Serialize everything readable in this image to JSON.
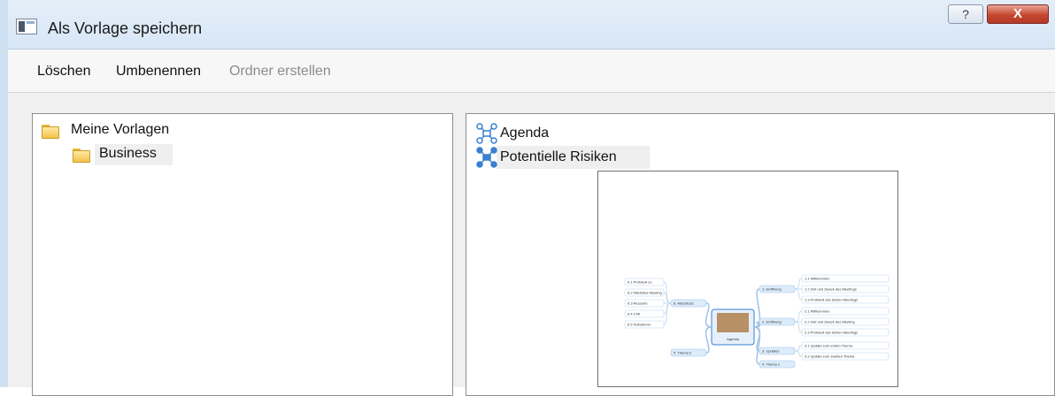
{
  "window": {
    "title": "Als Vorlage speichern",
    "help_label": "?",
    "close_label": "X"
  },
  "menu": {
    "items": [
      {
        "label": "Löschen",
        "enabled": true
      },
      {
        "label": "Umbenennen",
        "enabled": true
      },
      {
        "label": "Ordner erstellen",
        "enabled": false
      }
    ]
  },
  "folders": {
    "root": "Meine Vorlagen",
    "child": "Business"
  },
  "templates": [
    {
      "label": "Agenda"
    },
    {
      "label": "Potentielle Risiken"
    }
  ],
  "preview": {
    "center": "Agenda",
    "right_branches": [
      {
        "label": "1. Eröffnung",
        "children": [
          "1.1 Willkommen",
          "1.2 Zeit und Zweck des Meetings",
          "1.3 Protokoll des letzten Meetings"
        ]
      },
      {
        "label": "2. Eröffnung",
        "children": [
          "2.1 Willkommen",
          "2.2 Zeit und Zweck des Meeting",
          "2.3 Protokoll des letzten Meetings"
        ]
      },
      {
        "label": "3. Updates",
        "children": [
          "3.1 Update zum ersten Thema",
          "3.2 Update zum zweiten Thema"
        ]
      },
      {
        "label": "4. Thema 1",
        "children": []
      }
    ],
    "left_branches": [
      {
        "label": "6. Abschluss",
        "children": [
          "6.1 Protokoll zu",
          "6.2 Nächstes Meeting",
          "6.3 Ressorts",
          "6.4 3 Mi",
          "6.5 Teilnehmer"
        ]
      },
      {
        "label": "5. Thema 2",
        "children": []
      }
    ]
  },
  "colors": {
    "titlebar": "#dbe8f6",
    "close_button": "#c6472f",
    "folder": "#f3c24a",
    "mindmap_blue": "#3a7fd1",
    "node_fill": "#dcecfb"
  }
}
